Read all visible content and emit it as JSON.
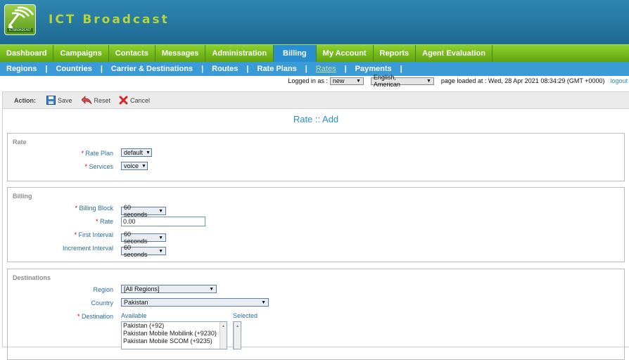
{
  "header": {
    "brand": "ICT Broadcast",
    "logo_text": "ICTBROADCAST"
  },
  "main_menu": [
    {
      "label": "Dashboard",
      "active": false
    },
    {
      "label": "Campaigns",
      "active": false
    },
    {
      "label": "Contacts",
      "active": false
    },
    {
      "label": "Messages",
      "active": false
    },
    {
      "label": "Administration",
      "active": false
    },
    {
      "label": "Billing",
      "active": true
    },
    {
      "label": "My Account",
      "active": false
    },
    {
      "label": "Reports",
      "active": false
    },
    {
      "label": "Agent Evaluation",
      "active": false
    }
  ],
  "sub_menu": [
    {
      "label": "Regions"
    },
    {
      "label": "Countries"
    },
    {
      "label": "Carrier & Destinations"
    },
    {
      "label": "Routes"
    },
    {
      "label": "Rate Plans"
    },
    {
      "label": "Rates",
      "current": true
    },
    {
      "label": "Payments"
    }
  ],
  "info": {
    "logged_in_label": "Logged in as :",
    "user": "new",
    "language": "English, American",
    "page_loaded": "page loaded at : Wed, 28 Apr 2021 08:34:29 (GMT +0000)",
    "logout": "logout"
  },
  "actions": {
    "label": "Action:",
    "save": "Save",
    "reset": "Reset",
    "cancel": "Cancel"
  },
  "page_title": "Rate :: Add",
  "rate_section": {
    "title": "Rate",
    "rate_plan_label": "Rate Plan",
    "rate_plan_value": "default",
    "services_label": "Services",
    "services_value": "voice"
  },
  "billing_section": {
    "title": "Billing",
    "billing_block_label": "Billing Block",
    "billing_block_value": "60 seconds",
    "rate_label": "Rate",
    "rate_value": "0.00",
    "first_interval_label": "First Interval",
    "first_interval_value": "60 seconds",
    "increment_interval_label": "Increment Interval",
    "increment_interval_value": "60 seconds"
  },
  "destinations_section": {
    "title": "Destinations",
    "region_label": "Region",
    "region_value": "[All Regions]",
    "country_label": "Country",
    "country_value": "Pakistan",
    "destination_label": "Destination",
    "available_label": "Available",
    "selected_label": "Selected",
    "available": [
      "Pakistan (+92)",
      "Pakistan Mobile Mobilink (+9230)",
      "Pakistan Mobile SCOM (+9235)"
    ]
  },
  "colors": {
    "accent_blue": "#2a8fd1",
    "menu_green": "#6fb81a",
    "required_red": "#dd0000"
  }
}
